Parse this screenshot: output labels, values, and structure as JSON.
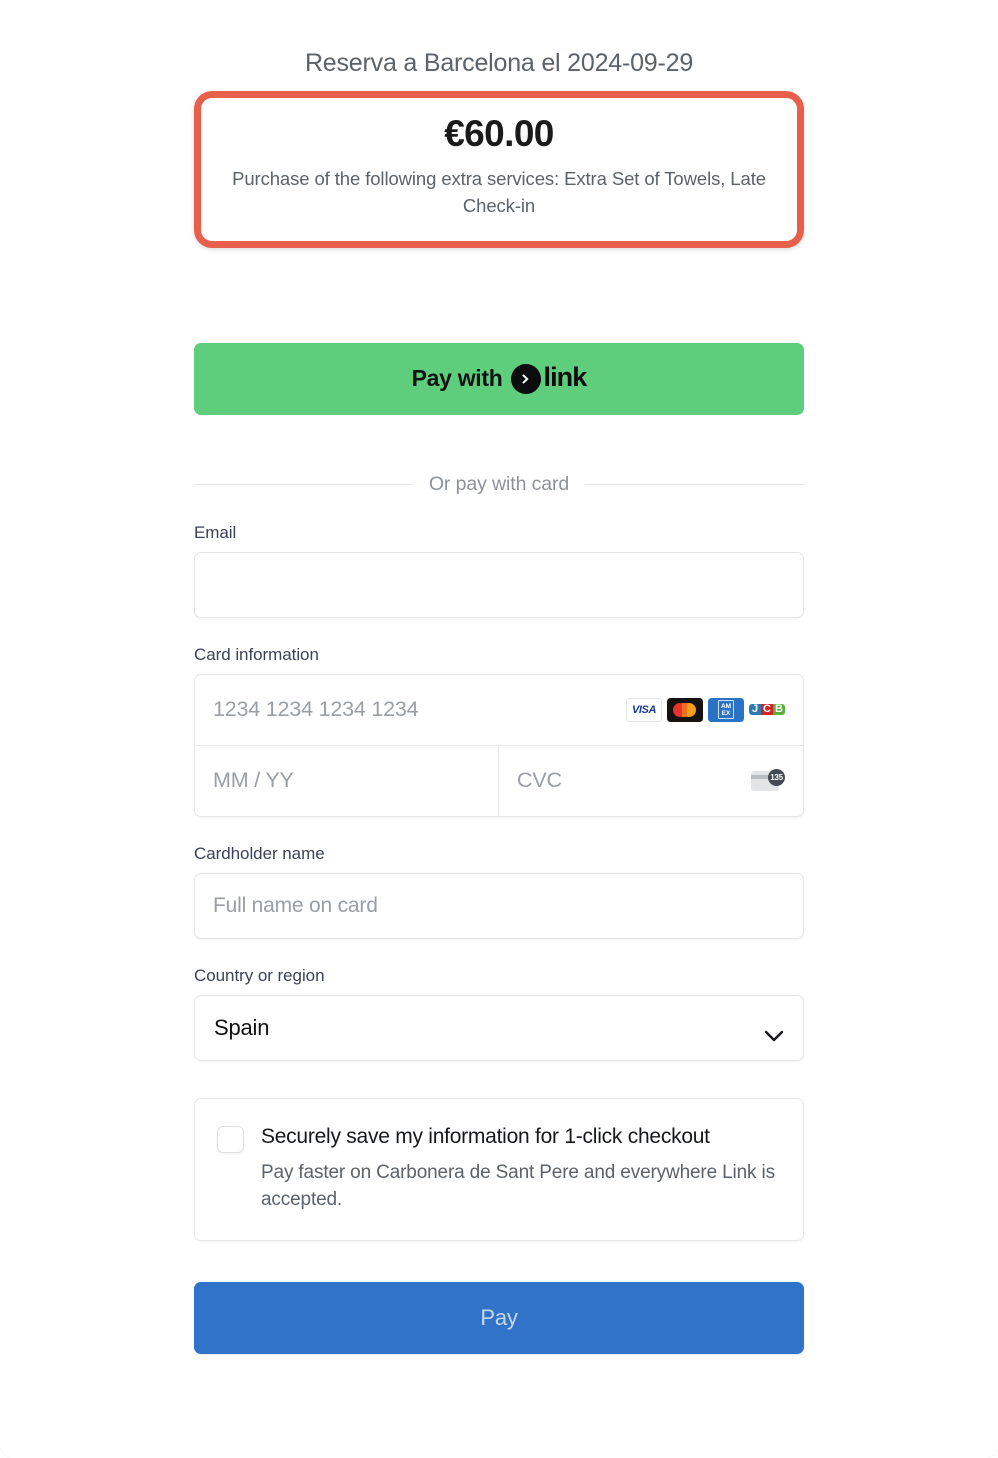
{
  "order": {
    "title": "Reserva a Barcelona el 2024-09-29",
    "amount": "€60.00",
    "description": "Purchase of the following extra services: Extra Set of Towels, Late Check-in",
    "highlight_color": "#e8604c"
  },
  "link_button": {
    "prefix_label": "Pay with",
    "wordmark": "link",
    "chevron_icon": "link-chevron-icon",
    "background_color": "#5fce7c"
  },
  "divider": {
    "label": "Or pay with card"
  },
  "email": {
    "label": "Email",
    "value": "",
    "placeholder": ""
  },
  "card": {
    "label": "Card information",
    "number_placeholder": "1234 1234 1234 1234",
    "number_value": "",
    "expiry_placeholder": "MM / YY",
    "expiry_value": "",
    "cvc_placeholder": "CVC",
    "cvc_value": "",
    "cvc_hint_digits": "135",
    "brands": [
      {
        "name": "visa",
        "text": "VISA"
      },
      {
        "name": "mastercard",
        "text": ""
      },
      {
        "name": "amex",
        "line1": "AM",
        "line2": "EX"
      },
      {
        "name": "jcb",
        "j": "J",
        "c": "C",
        "b": "B"
      }
    ]
  },
  "cardholder": {
    "label": "Cardholder name",
    "placeholder": "Full name on card",
    "value": ""
  },
  "country": {
    "label": "Country or region",
    "selected": "Spain",
    "chevron_icon": "chevron-down-icon"
  },
  "save_info": {
    "checked": false,
    "title": "Securely save my information for 1-click checkout",
    "subtitle": "Pay faster on Carbonera de Sant Pere and everywhere Link is accepted."
  },
  "pay_button": {
    "label": "Pay",
    "background_color": "#3173c9"
  }
}
